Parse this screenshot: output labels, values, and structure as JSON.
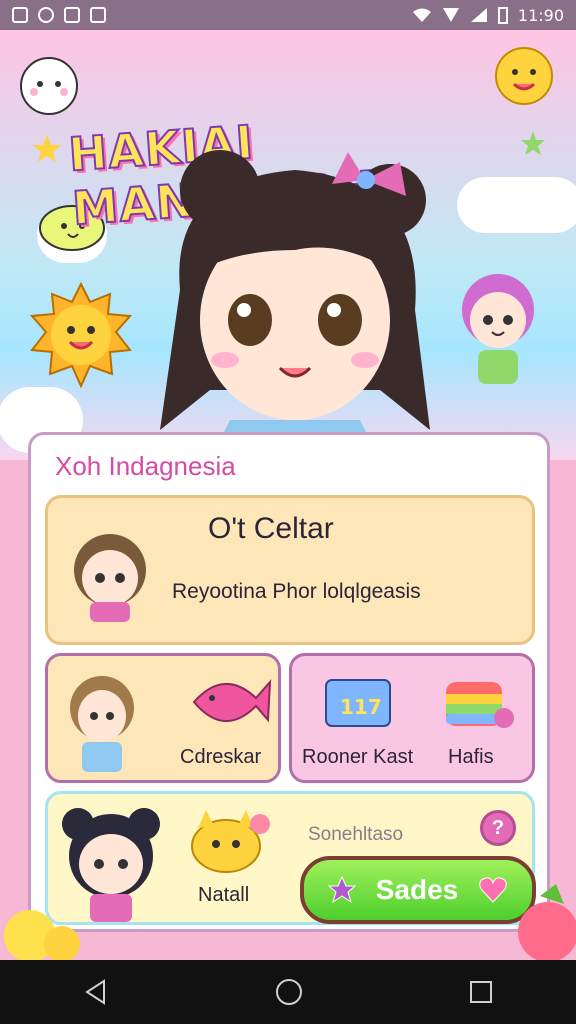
{
  "status_bar": {
    "time": "11:90"
  },
  "hero": {
    "app_title": "HAKIAI MANGALRH"
  },
  "panel": {
    "title": "Xoh Indagnesia",
    "main_card": {
      "title": "O't Celtar",
      "subtitle": "Reyootina Phor lolqlgeasis"
    },
    "card_a": {
      "label": "Cdreskar"
    },
    "card_b": {
      "left_label": "Rooner Kast",
      "right_label": "Hafis"
    },
    "card_c": {
      "label": "Natall",
      "search_text": "Sonehltaso",
      "help_symbol": "?",
      "button_label": "Sades"
    }
  },
  "colors": {
    "accent_pink": "#d44ca3",
    "button_green": "#4fcf2e",
    "panel_border": "#c99bc7"
  },
  "icons": [
    "image-icon",
    "settings-icon",
    "wifi-icon",
    "signal-icon",
    "battery-icon",
    "back-icon",
    "home-icon",
    "recents-icon",
    "help-icon",
    "star-icon",
    "heart-icon"
  ]
}
